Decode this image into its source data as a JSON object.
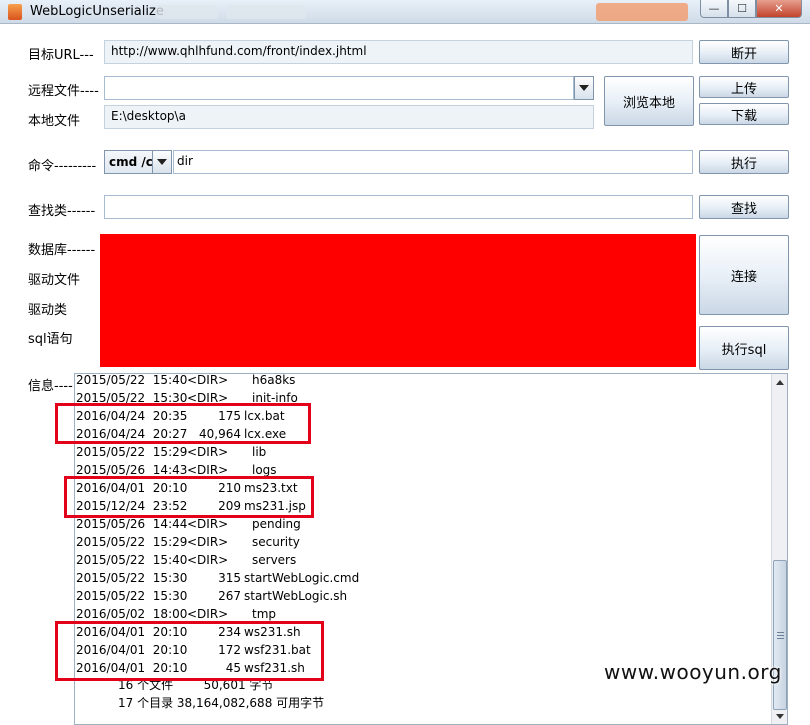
{
  "window": {
    "title": "WebLogicUnserialize",
    "controls": {
      "minimize": "—",
      "maximize": "☐",
      "close": "✕"
    }
  },
  "form": {
    "target_url_label": "目标URL---",
    "target_url_value": "http://www.qhlhfund.com/front/index.jhtml",
    "disconnect_button": "断开",
    "remote_file_label": "远程文件----",
    "remote_file_value": "",
    "browse_local_button": "浏览本地",
    "upload_button": "上传",
    "local_file_label": "本地文件",
    "local_file_value": "E:\\desktop\\a",
    "download_button": "下载",
    "command_label": "命令---------",
    "command_type": "cmd /c",
    "command_value": "dir",
    "execute_button": "执行",
    "find_class_label": "查找类------",
    "find_class_value": "",
    "find_button": "查找",
    "database_label": "数据库------",
    "driver_file_label": "驱动文件",
    "driver_class_label": "驱动类",
    "sql_label": "sql语句",
    "connect_button": "连接",
    "execute_sql_button": "执行sql",
    "info_label": "信息----"
  },
  "info_lines": [
    {
      "date": "2015/05/22  15:40",
      "dir": "<DIR>",
      "size": "",
      "name": "h6a8ks"
    },
    {
      "date": "2015/05/22  15:30",
      "dir": "<DIR>",
      "size": "",
      "name": "init-info"
    },
    {
      "date": "2016/04/24  20:35",
      "dir": "",
      "size": "175",
      "name": "lcx.bat"
    },
    {
      "date": "2016/04/24  20:27",
      "dir": "",
      "size": "40,964",
      "name": "lcx.exe"
    },
    {
      "date": "2015/05/22  15:29",
      "dir": "<DIR>",
      "size": "",
      "name": "lib"
    },
    {
      "date": "2015/05/26  14:43",
      "dir": "<DIR>",
      "size": "",
      "name": "logs"
    },
    {
      "date": "2016/04/01  20:10",
      "dir": "",
      "size": "210",
      "name": "ms23.txt"
    },
    {
      "date": "2015/12/24  23:52",
      "dir": "",
      "size": "209",
      "name": "ms231.jsp"
    },
    {
      "date": "2015/05/26  14:44",
      "dir": "<DIR>",
      "size": "",
      "name": "pending"
    },
    {
      "date": "2015/05/22  15:29",
      "dir": "<DIR>",
      "size": "",
      "name": "security"
    },
    {
      "date": "2015/05/22  15:40",
      "dir": "<DIR>",
      "size": "",
      "name": "servers"
    },
    {
      "date": "2015/05/22  15:30",
      "dir": "",
      "size": "315",
      "name": "startWebLogic.cmd"
    },
    {
      "date": "2015/05/22  15:30",
      "dir": "",
      "size": "267",
      "name": "startWebLogic.sh"
    },
    {
      "date": "2016/05/02  18:00",
      "dir": "<DIR>",
      "size": "",
      "name": "tmp"
    },
    {
      "date": "2016/04/01  20:10",
      "dir": "",
      "size": "234",
      "name": "ws231.sh"
    },
    {
      "date": "2016/04/01  20:10",
      "dir": "",
      "size": "172",
      "name": "wsf231.bat"
    },
    {
      "date": "2016/04/01  20:10",
      "dir": "",
      "size": "45",
      "name": "wsf231.sh"
    }
  ],
  "summary": {
    "files": "16 个文件        50,601 字节",
    "dirs": "17 个目录 38,164,082,688 可用字节"
  },
  "watermark": "www.wooyun.org",
  "colors": {
    "redaction": "#ff0000",
    "highlight": "#e3001b"
  }
}
